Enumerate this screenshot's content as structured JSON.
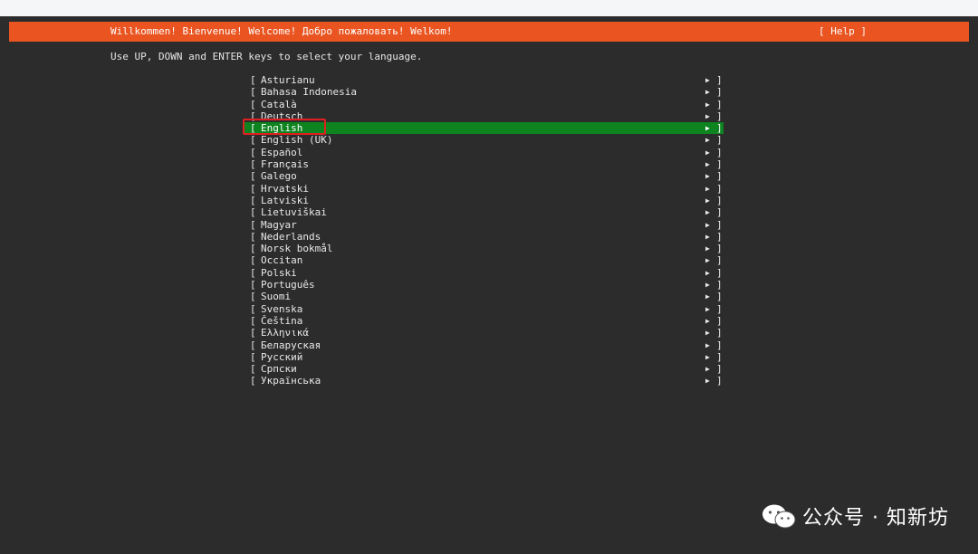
{
  "header": {
    "title": "Willkommen! Bienvenue! Welcome! Добро пожаловать! Welkom!",
    "help_label": "[ Help ]",
    "color": "#e95420"
  },
  "instructions": "Use UP, DOWN and ENTER keys to select your language.",
  "languages": [
    "Asturianu",
    "Bahasa Indonesia",
    "Català",
    "Deutsch",
    "English",
    "English (UK)",
    "Español",
    "Français",
    "Galego",
    "Hrvatski",
    "Latviski",
    "Lietuviškai",
    "Magyar",
    "Nederlands",
    "Norsk bokmål",
    "Occitan",
    "Polski",
    "Português",
    "Suomi",
    "Svenska",
    "Čeština",
    "Ελληνικά",
    "Беларуская",
    "Русский",
    "Српски",
    "Українська"
  ],
  "selected_language": "English",
  "selection_color": "#0e8420",
  "highlight_color": "#e02020",
  "watermark": {
    "text": "公众号 · 知新坊",
    "icon": "wechat-icon"
  }
}
